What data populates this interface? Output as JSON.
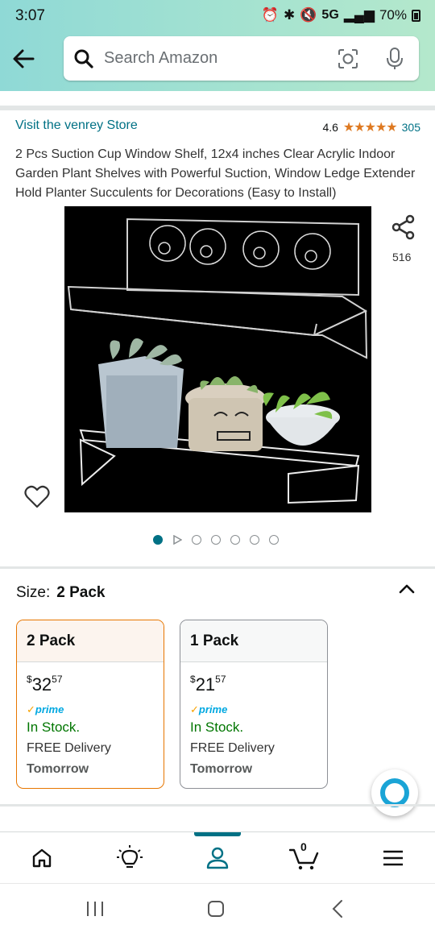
{
  "status_bar": {
    "time": "3:07",
    "network": "5G",
    "battery": "70%"
  },
  "search": {
    "placeholder": "Search Amazon"
  },
  "product": {
    "store_link": "Visit the venrey Store",
    "rating_value": "4.6",
    "stars": "★★★★★",
    "rating_count": "305",
    "title": "2 Pcs Suction Cup Window Shelf, 12x4 inches Clear Acrylic Indoor Garden Plant Shelves with Powerful Suction, Window Ledge Extender Hold Planter Succulents for Decorations (Easy to Install)",
    "share_count": "516",
    "image_count": 6,
    "current_image": 1
  },
  "size_selector": {
    "label": "Size:",
    "value": "2 Pack",
    "options": [
      {
        "name": "2 Pack",
        "price_symbol": "$",
        "price_whole": "32",
        "price_fraction": "57",
        "prime": "prime",
        "stock": "In Stock.",
        "delivery": "FREE Delivery",
        "delivery_day": "Tomorrow",
        "selected": true
      },
      {
        "name": "1 Pack",
        "price_symbol": "$",
        "price_whole": "21",
        "price_fraction": "57",
        "prime": "prime",
        "stock": "In Stock.",
        "delivery": "FREE Delivery",
        "delivery_day": "Tomorrow",
        "selected": false
      }
    ]
  },
  "bottom_nav": {
    "items": [
      "home-icon",
      "lightbulb-icon",
      "account-icon",
      "cart-icon",
      "menu-icon"
    ],
    "active": "account-icon",
    "cart_count": "0"
  },
  "colors": {
    "link": "#007185",
    "star": "#de7921",
    "in_stock": "#007600",
    "selected_border": "#e77600",
    "prime": "#00a8e1"
  }
}
